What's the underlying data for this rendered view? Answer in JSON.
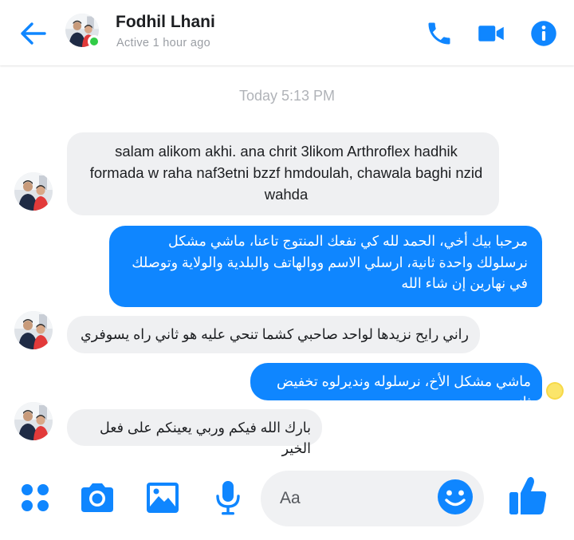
{
  "header": {
    "contact_name": "Fodhil Lhani",
    "status": "Active 1 hour ago",
    "icons": [
      "back-arrow-icon",
      "phone-icon",
      "video-camera-icon",
      "info-icon"
    ],
    "accent_color": "#0f86ff",
    "online_color": "#31cc46"
  },
  "chat": {
    "timestamp": "Today 5:13 PM",
    "messages": [
      {
        "direction": "incoming",
        "text": "salam alikom akhi. ana chrit 3likom Arthroflex hadhik formada w raha naf3etni bzzf hmdoulah, chawala baghi nzid wahda"
      },
      {
        "direction": "outgoing",
        "text": "مرحبا بيك أخي، الحمد لله كي نفعك المنتوج تاعنا، ماشي مشكل نرسلولك واحدة ثانية، ارسلي الاسم ووالهاتف والبلدية والولاية وتوصلك في نهارين إن شاء الله"
      },
      {
        "direction": "incoming",
        "text": "راني رايح نزيدها لواحد صاحبي كشما تنحي عليه هو ثاني راه يسوفري"
      },
      {
        "direction": "outgoing",
        "text": "ماشي مشكل الأخ، نرسلوله ونديرلوه تخفيض ثاني"
      },
      {
        "direction": "incoming",
        "text": "بارك الله فيكم وربي يعينكم على فعل الخير"
      }
    ],
    "incoming_bubble_color": "#eff0f2",
    "outgoing_bubble_color": "#0f86ff"
  },
  "composer": {
    "placeholder": "Aa",
    "icons": [
      "apps-grid-icon",
      "camera-icon",
      "gallery-icon",
      "microphone-icon",
      "emoji-icon",
      "thumbs-up-icon"
    ]
  }
}
